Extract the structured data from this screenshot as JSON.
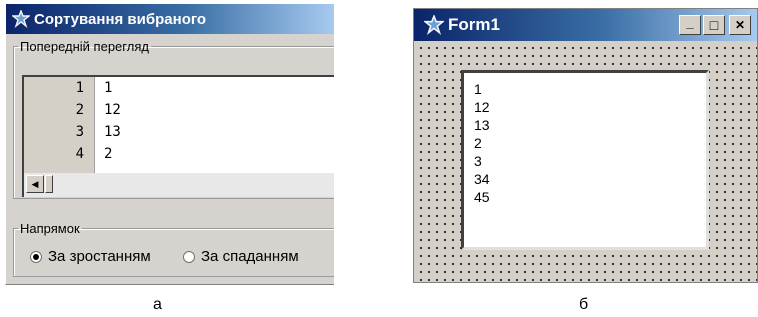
{
  "panel_a": {
    "title": "Сортування вибраного",
    "preview_group_label": "Попередній перегляд",
    "preview_lines": [
      {
        "num": "1",
        "text": "1"
      },
      {
        "num": "2",
        "text": "12"
      },
      {
        "num": "3",
        "text": "13"
      },
      {
        "num": "4",
        "text": "2"
      }
    ],
    "direction_group_label": "Напрямок",
    "radio_ascending": {
      "label": "За зростанням",
      "selected": true
    },
    "radio_descending": {
      "label": "За спаданням",
      "selected": false
    },
    "caption": "а"
  },
  "panel_b": {
    "title": "Form1",
    "minimize_glyph": "_",
    "maximize_glyph": "□",
    "close_glyph": "✕",
    "list_items": [
      "1",
      "12",
      "13",
      "2",
      "3",
      "34",
      "45"
    ],
    "caption": "б"
  },
  "colors": {
    "titlebar_start": "#0a246a",
    "titlebar_end": "#a6caf0",
    "window_face": "#d4d0c8"
  },
  "icons": {
    "app": "gear-form-icon",
    "scroll_left": "left-arrow-icon",
    "radio_selected": "radio-checked-icon",
    "radio_unselected": "radio-unchecked-icon"
  }
}
